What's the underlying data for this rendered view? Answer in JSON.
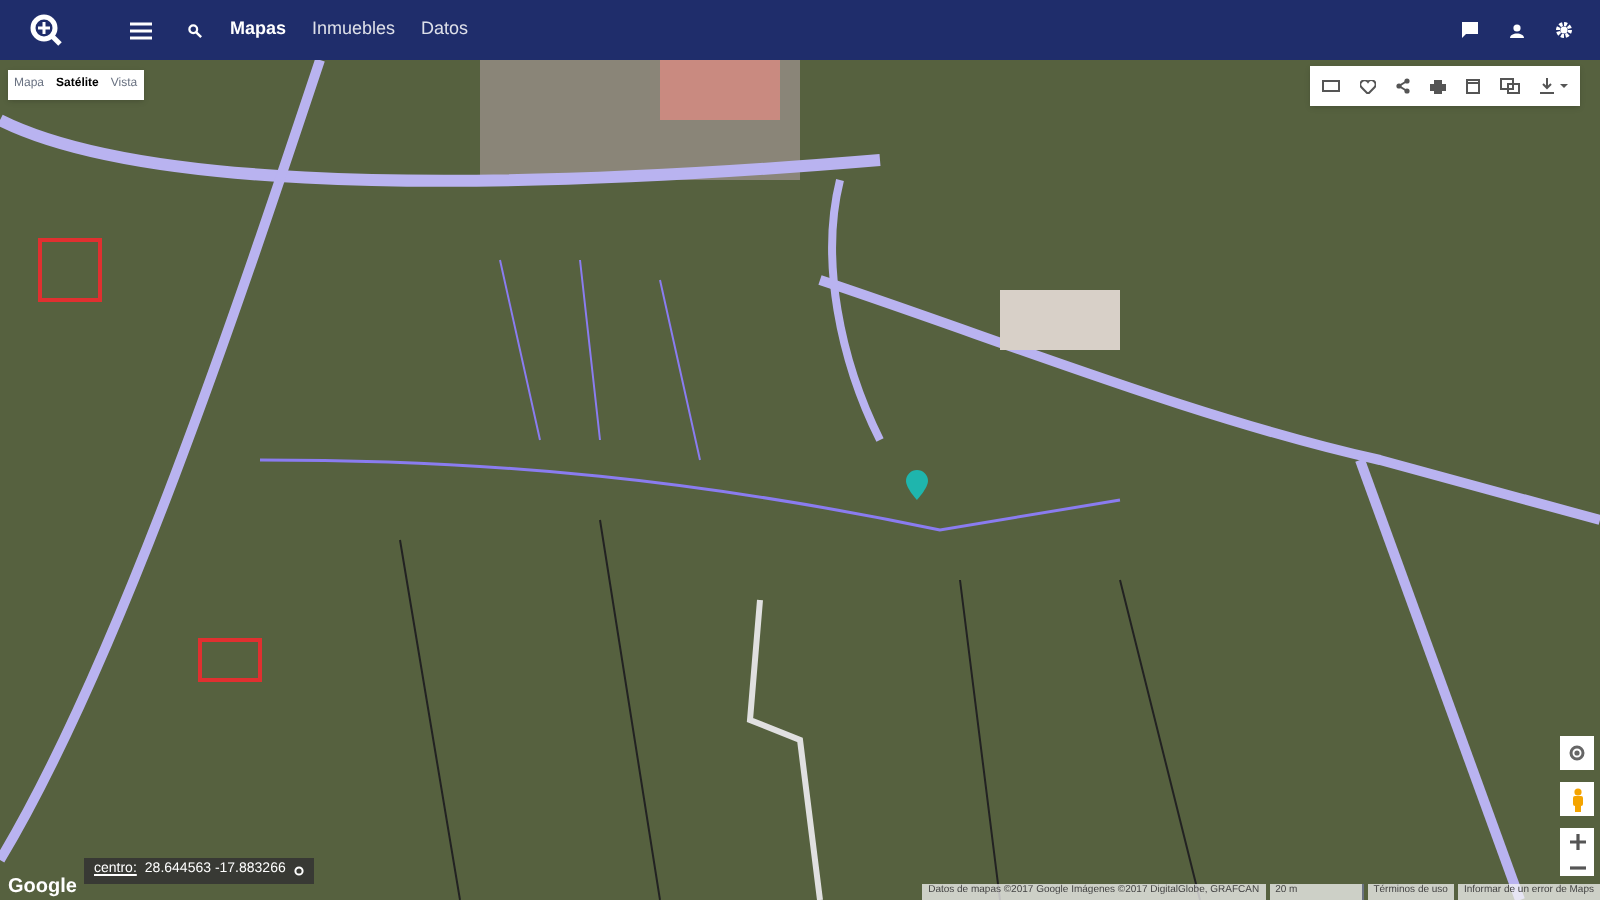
{
  "header": {
    "nav": [
      {
        "label": "Mapas",
        "selected": true
      },
      {
        "label": "Inmuebles",
        "selected": false
      },
      {
        "label": "Datos",
        "selected": false
      }
    ]
  },
  "map_types": [
    {
      "label": "Mapa",
      "selected": false
    },
    {
      "label": "Satélite",
      "selected": true
    },
    {
      "label": "Vista",
      "selected": false
    }
  ],
  "coordinates": {
    "label": "centro:",
    "value": "28.644563 -17.883266"
  },
  "attribution": [
    "Google"
  ],
  "footer": [
    {
      "kind": "text",
      "text": "Datos de mapas ©2017 Google Imágenes ©2017 DigitalGlobe, GRAFCAN"
    },
    {
      "kind": "scale",
      "text": "20 m"
    },
    {
      "kind": "link",
      "text": "Términos de uso"
    },
    {
      "kind": "link",
      "text": "Informar de un error de Maps"
    }
  ]
}
